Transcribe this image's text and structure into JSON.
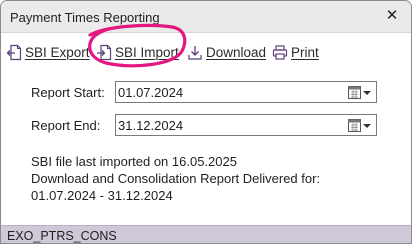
{
  "window": {
    "title": "Payment Times Reporting",
    "close_glyph": "✕"
  },
  "toolbar": {
    "export": {
      "label": "SBI Export",
      "icon": "export-document-icon"
    },
    "import": {
      "label": "SBI Import",
      "icon": "import-document-icon"
    },
    "download": {
      "label": "Download",
      "icon": "download-icon"
    },
    "print": {
      "label": "Print",
      "icon": "printer-icon"
    }
  },
  "form": {
    "report_start": {
      "label": "Report Start:",
      "value": "01.07.2024"
    },
    "report_end": {
      "label": "Report End:",
      "value": "31.12.2024"
    }
  },
  "info": {
    "line1": "SBI file last imported on 16.05.2025",
    "line2": "Download and Consolidation Report Delivered for:",
    "line3": "01.07.2024 - 31.12.2024"
  },
  "status_bar": {
    "text": "EXO_PTRS_CONS"
  },
  "colors": {
    "icon": "#5b3f7a",
    "annotation_ring": "#e3177f",
    "status_bar_bg": "#cfc8d8",
    "title_bar_bg": "#eaeaea"
  }
}
